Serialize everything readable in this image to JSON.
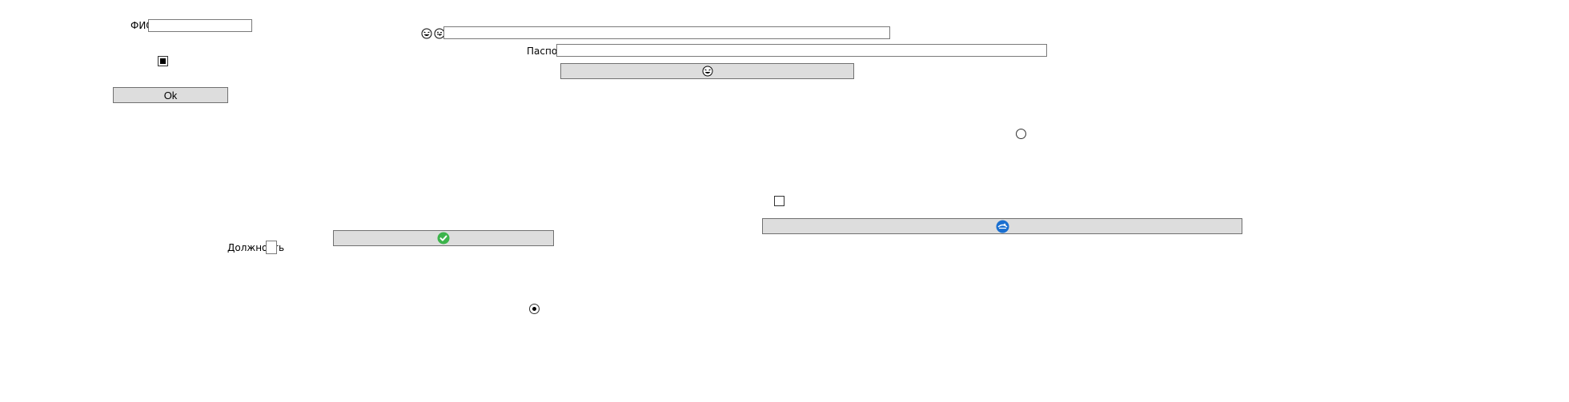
{
  "form": {
    "fio_label": "ФИО",
    "fio_value": "",
    "ok_label": "Ok",
    "dolzhnost_label": "Должность",
    "passport_label": "Паспорт",
    "passport_value": "",
    "top_input_value": "",
    "checkbox_top_checked": true,
    "checkbox_right_checked": false,
    "dolzhnost_checked": false,
    "radio_right_selected": false,
    "radio_bottom_selected": true
  },
  "icons": {
    "smiley_1": "laughing-face-icon",
    "smiley_2": "tongue-face-icon",
    "smiley_button": "laughing-face-icon",
    "check_button": "green-check-circle-icon",
    "blue_button": "blue-circle-icon"
  },
  "colors": {
    "button_bg": "#dddddd",
    "check_green": "#3cb44b",
    "blue_icon": "#1a6fd0"
  }
}
